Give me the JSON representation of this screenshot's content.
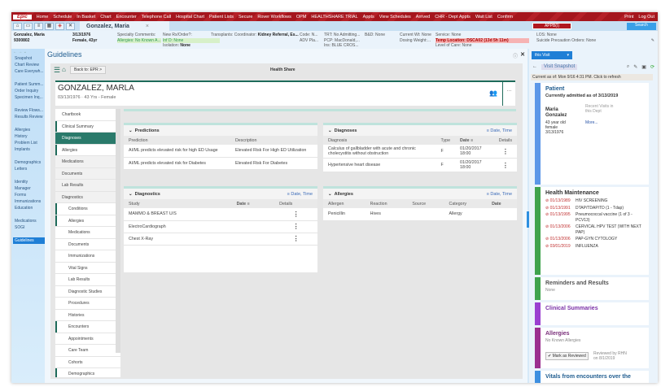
{
  "topbar": {
    "logo": "Epic",
    "items": [
      "Home",
      "Schedule",
      "In Basket",
      "Chart",
      "Encounter",
      "Telephone Call",
      "Hospital Chart",
      "Patient Lists",
      "Secure",
      "Rover Workflows",
      "OPM",
      "HEALTHSHARE TRIAL",
      "Appts",
      "View Schedules",
      "Arrived",
      "CHR - Dept Appts",
      "Wait List",
      "Confirm"
    ],
    "right": [
      "Print",
      "Log Out"
    ]
  },
  "tabs": {
    "patient_tab": "Gonzalez, Maria",
    "appt_banner": "APPB(I)",
    "search_placeholder": "Search"
  },
  "patient_header": {
    "name": "Gonzalez, Maria",
    "mrn": "9300802",
    "dob": "3/13/1976",
    "sex_age": "Female, 43yr",
    "specialty_comments": "Specialty Comments:",
    "allergies": "Allergies: No Known A...",
    "new_rx": "New Rx/Order?:",
    "inf_d": "Inf D: None",
    "isolation_label": "Isolation:",
    "isolation": "None",
    "transplants": "Transplants: Coordinator:",
    "transplant_value": "Kidney Referral, Es...",
    "code": "Code: N...",
    "adv": "ADV Pla...",
    "trt": "TRT: No Admitting...",
    "pcp": "PCP: MacDonald,...",
    "ins": "Ins: BLUE CROS...",
    "bd": "B&D: None",
    "current_wt": "Current Wt: None",
    "dosing_wt": "Dosing Weight:...",
    "service": "Service: None",
    "temp_location": "Temp Location: DSCA02 (13d 5h 11m)",
    "level_of_care": "Level of Care: None",
    "los": "LOS: None",
    "suicide": "Suicide Precaution Orders: None"
  },
  "left_nav": [
    "Snapshot",
    "Chart Review",
    "Care Everywh...",
    "",
    "Patient Summ...",
    "Order Inquiry",
    "Specimen Inq...",
    "",
    "Review Flows...",
    "Results Review",
    "",
    "Allergies",
    "History",
    "Problem List",
    "Implants",
    "",
    "Demographics",
    "Letters",
    "",
    "Identity Manager",
    "",
    "Forms",
    "Immunizations",
    "Education",
    "",
    "Medications",
    "SOGI",
    "",
    "Guidelines"
  ],
  "main": {
    "title": "Guidelines",
    "back_label": "Back to: EPR",
    "center_title": "Health Share",
    "patient_name": "GONZALEZ, MARLA",
    "patient_info": "03/13/1976 · 43 Yrs - Female",
    "tree": [
      {
        "label": "Chartbook",
        "cls": ""
      },
      {
        "label": "Clinical Summary",
        "cls": "bar"
      },
      {
        "label": "Diagnoses",
        "cls": "sel"
      },
      {
        "label": "Allergies",
        "cls": "bar"
      },
      {
        "label": "Medications",
        "cls": "gray"
      },
      {
        "label": "Documents",
        "cls": "gray"
      },
      {
        "label": "Lab Results",
        "cls": "gray"
      },
      {
        "label": "Diagnostics",
        "cls": "gray"
      },
      {
        "label": "Conditions",
        "cls": "l2 bar"
      },
      {
        "label": "Allergies",
        "cls": "l2 bar"
      },
      {
        "label": "Medications",
        "cls": "l2"
      },
      {
        "label": "Documents",
        "cls": "l2"
      },
      {
        "label": "Immunizations",
        "cls": "l2"
      },
      {
        "label": "Vital Signs",
        "cls": "l2"
      },
      {
        "label": "Lab Results",
        "cls": "l2"
      },
      {
        "label": "Diagnostic Studies",
        "cls": "l2"
      },
      {
        "label": "Procedures",
        "cls": "l2"
      },
      {
        "label": "Histories",
        "cls": "l2"
      },
      {
        "label": "Encounters",
        "cls": "l2 bar"
      },
      {
        "label": "Appointments",
        "cls": "l2"
      },
      {
        "label": "Care Team",
        "cls": "l2"
      },
      {
        "label": "Cohorts",
        "cls": "l2"
      },
      {
        "label": "Demographics",
        "cls": "l2 bar"
      }
    ],
    "predictions": {
      "title": "Predictions",
      "columns": [
        "Prediction",
        "Description"
      ],
      "rows": [
        [
          "AI/ML predicts elevated risk for high ED Usage",
          "Elevated Risk For High ED Utilization"
        ],
        [
          "AI/ML predicts elevated risk for Diabetes",
          "Elevated Risk For Diabetes"
        ]
      ]
    },
    "diagnostics": {
      "title": "Diagnostics",
      "sort": "Date, Time",
      "columns": [
        "Study",
        "Date",
        "Details"
      ],
      "rows": [
        "MAMMO & BREAST U/S",
        "ElectroCardiograph",
        "Chest X-Ray"
      ]
    },
    "diagnoses": {
      "title": "Diagnoses",
      "sort": "Date, Time",
      "columns": [
        "Diagnosis",
        "Type",
        "Date",
        "Details"
      ],
      "rows": [
        [
          "Calculus of gallbladder with acute and chronic cholecystitis without obstruction",
          "F",
          "01/20/2017 18:00"
        ],
        [
          "Hypertensive heart disease",
          "F",
          "01/20/2017 18:00"
        ]
      ]
    },
    "allergies": {
      "title": "Allergies",
      "sort": "Date, Time",
      "columns": [
        "Allergen",
        "Reaction",
        "Source",
        "Category",
        "Date"
      ],
      "rows": [
        [
          "Penicillin",
          "Hives",
          "",
          "Allergy",
          ""
        ]
      ]
    }
  },
  "right_panel": {
    "dropdown": "this Visit",
    "snapshot": "Visit Snapshot",
    "current_as_of": "Current as of: Mon 9/16 4:31 PM. Click to refresh",
    "patient": {
      "title": "Patient",
      "admitted": "Currently admitted as of 3/13/2019",
      "name": "Maria Gonzalez",
      "age": "43 year old female",
      "dob": "3/13/1976",
      "recent": "Recent Visits in this Dept",
      "more": "More..."
    },
    "health_maintenance": {
      "title": "Health Maintenance",
      "items": [
        [
          "01/13/1989",
          "HIV SCREENING"
        ],
        [
          "01/13/1991",
          "DTAP/TDAP/TD (1 - Tdap)"
        ],
        [
          "01/13/1995",
          "Pneumococcal vaccine (1 of 3 - PCV13)"
        ],
        [
          "01/13/2006",
          "CERVICAL HPV TEST (WITH NEXT PAP)"
        ],
        [
          "01/13/2006",
          "PAP-GYN CYTOLOGY"
        ],
        [
          "03/01/2019",
          "INFLUENZA"
        ]
      ]
    },
    "reminders": {
      "title": "Reminders and Results",
      "value": "None"
    },
    "clinical_summaries": {
      "title": "Clinical Summaries"
    },
    "allergies": {
      "title": "Allergies",
      "value": "No Known Allergies",
      "button": "Mark as Reviewed",
      "reviewed": "Reviewed by RHN on 8/1/2019"
    },
    "vitals": {
      "title": "Vitals from encounters over the"
    }
  },
  "colors": {
    "epic_red": "#a5161d",
    "teal": "#1e6b5a",
    "link": "#2954a8"
  }
}
